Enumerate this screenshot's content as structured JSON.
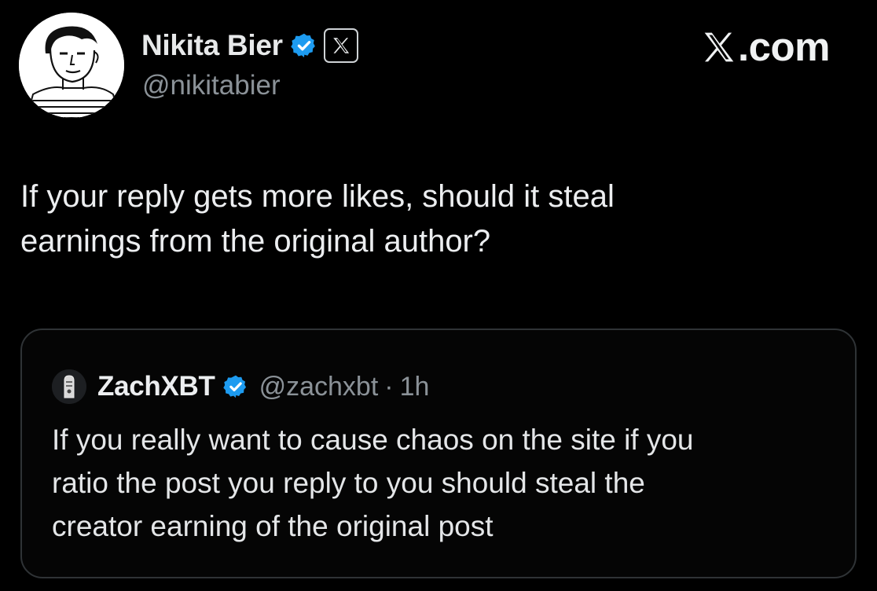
{
  "author": {
    "display_name": "Nikita Bier",
    "handle": "@nikitabier",
    "verified_icon": "verified-badge-icon",
    "affiliate_icon": "x-affiliate-badge-icon",
    "avatar_icon": "avatar-sketch-icon"
  },
  "site": {
    "label": ".com",
    "logo_icon": "x-logo-icon"
  },
  "tweet": {
    "lines": [
      "If your reply gets more likes, should it steal",
      "earnings from the original author?"
    ]
  },
  "quote": {
    "display_name": "ZachXBT",
    "handle": "@zachxbt",
    "separator": "·",
    "time": "1h",
    "lines": [
      "If you really want to cause chaos on the site if you",
      "ratio the post you reply to you should steal the",
      "creator earning of the original post"
    ]
  },
  "colors": {
    "background": "#000000",
    "text": "#e7e9ea",
    "secondary_text": "#8b9298",
    "verified_blue": "#1d9bf0",
    "card_border": "#2f3336"
  }
}
